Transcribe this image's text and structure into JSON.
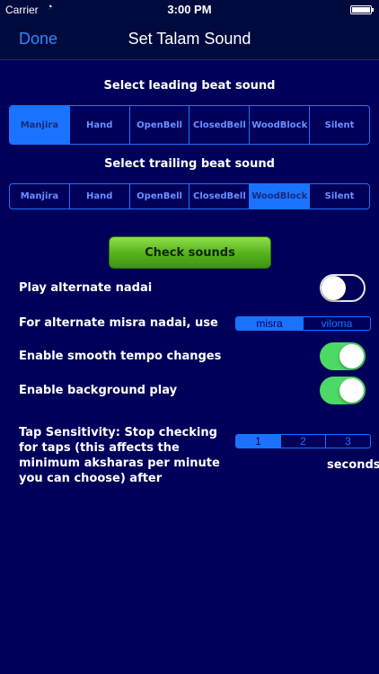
{
  "status": {
    "carrier": "Carrier",
    "time": "3:00 PM"
  },
  "nav": {
    "done": "Done",
    "title": "Set Talam Sound"
  },
  "leading": {
    "label": "Select leading beat sound",
    "options": [
      "Manjira",
      "Hand",
      "OpenBell",
      "ClosedBell",
      "WoodBlock",
      "Silent"
    ],
    "selected": "Manjira"
  },
  "trailing": {
    "label": "Select trailing beat sound",
    "options": [
      "Manjira",
      "Hand",
      "OpenBell",
      "ClosedBell",
      "WoodBlock",
      "Silent"
    ],
    "selected": "WoodBlock"
  },
  "check_button": "Check sounds",
  "settings": {
    "alternate_nadai": {
      "label": "Play alternate nadai",
      "on": false
    },
    "misra": {
      "label": "For alternate misra nadai, use",
      "options": [
        "misra",
        "viloma"
      ],
      "selected": "misra"
    },
    "smooth_tempo": {
      "label": "Enable smooth tempo changes",
      "on": true
    },
    "background_play": {
      "label": "Enable background play",
      "on": true
    },
    "tap": {
      "label": "Tap Sensitivity: Stop checking for taps (this affects the minimum aksharas per minute you can choose) after",
      "options": [
        "1",
        "2",
        "3"
      ],
      "selected": "1",
      "unit": "seconds"
    }
  },
  "colors": {
    "accent": "#1a73ff",
    "background": "#00005a",
    "switch_on": "#4cd964",
    "button_green": "#58b41f"
  }
}
